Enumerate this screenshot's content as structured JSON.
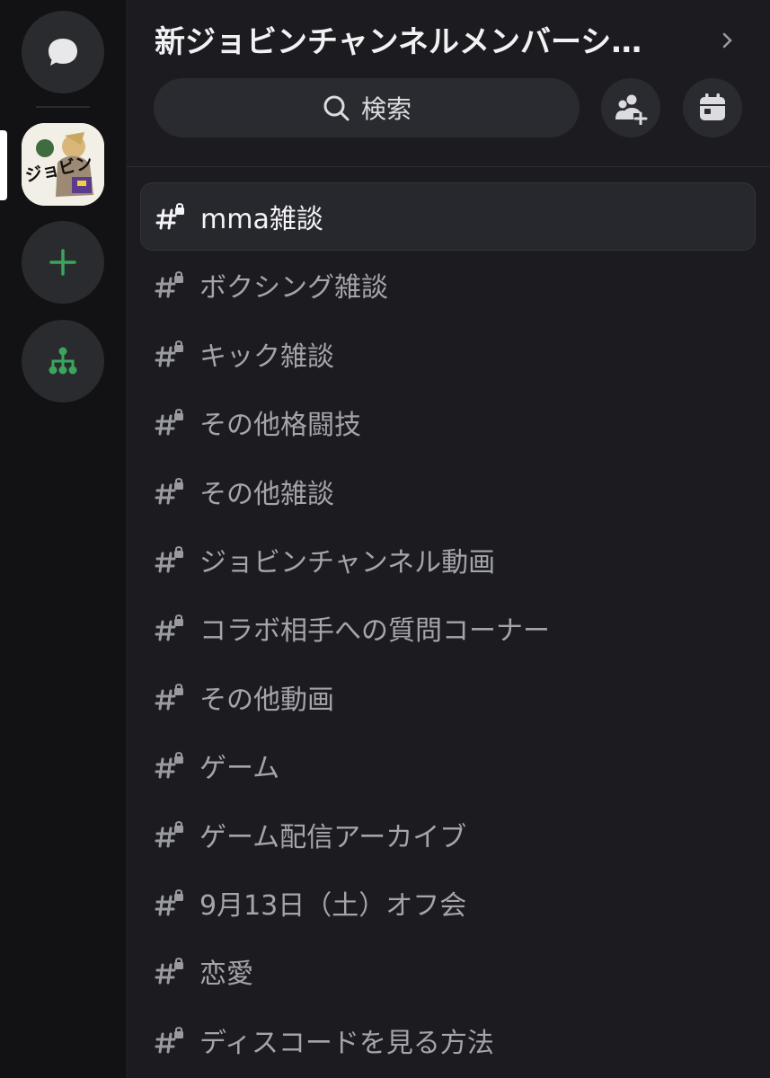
{
  "server": {
    "name": "新ジョビンチャンネルメンバーシ…",
    "logo_text": "ジョビン"
  },
  "search": {
    "label": "検索"
  },
  "channels": [
    {
      "name": "mma雑談",
      "active": true
    },
    {
      "name": "ボクシング雑談",
      "active": false
    },
    {
      "name": "キック雑談",
      "active": false
    },
    {
      "name": "その他格闘技",
      "active": false
    },
    {
      "name": "その他雑談",
      "active": false
    },
    {
      "name": "ジョビンチャンネル動画",
      "active": false
    },
    {
      "name": "コラボ相手への質問コーナー",
      "active": false
    },
    {
      "name": "その他動画",
      "active": false
    },
    {
      "name": "ゲーム",
      "active": false
    },
    {
      "name": "ゲーム配信アーカイブ",
      "active": false
    },
    {
      "name": "9月13日（土）オフ会",
      "active": false
    },
    {
      "name": "恋愛",
      "active": false
    },
    {
      "name": "ディスコードを見る方法",
      "active": false
    }
  ],
  "colors": {
    "accent_green": "#3ba55d",
    "background": "#1c1c20",
    "rail": "#121214"
  }
}
